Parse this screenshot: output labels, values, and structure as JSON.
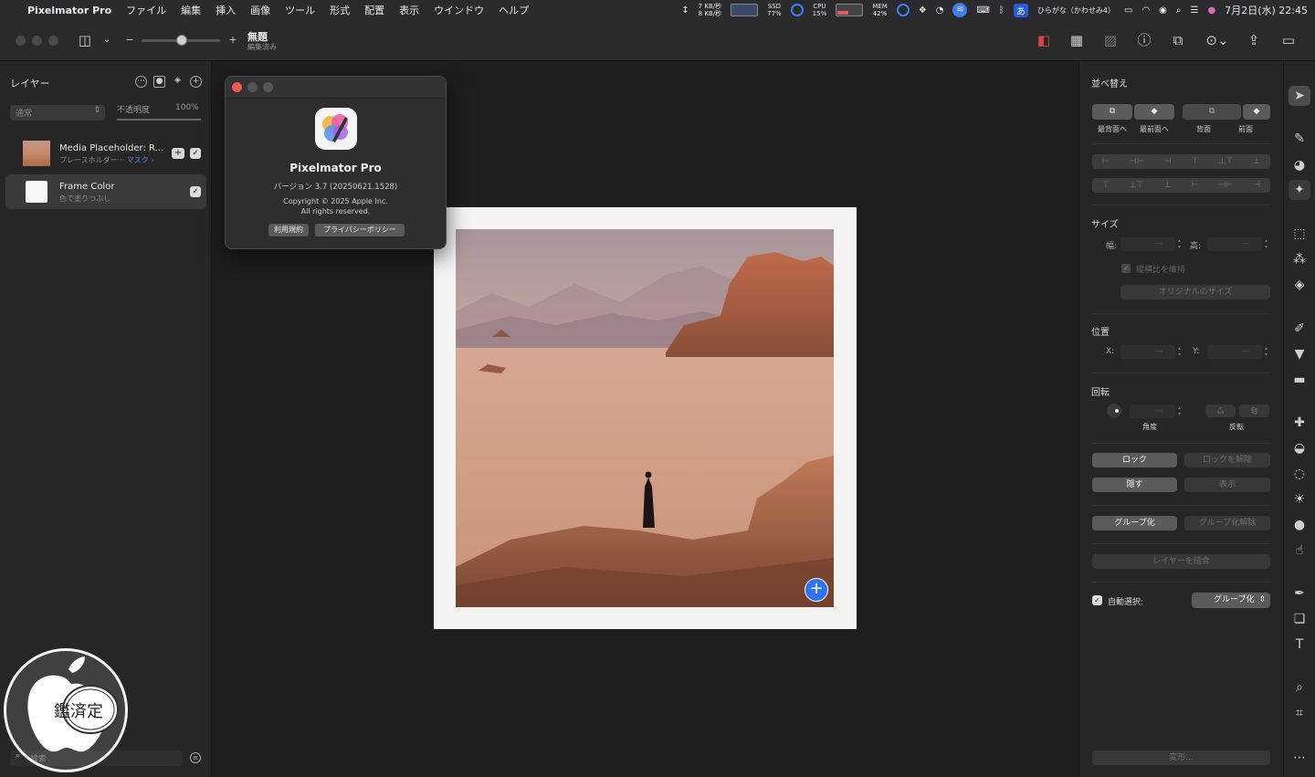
{
  "menubar": {
    "app_name": "Pixelmator Pro",
    "menus": [
      "ファイル",
      "編集",
      "挿入",
      "画像",
      "ツール",
      "形式",
      "配置",
      "表示",
      "ウインドウ",
      "ヘルプ"
    ],
    "net_up": "7 KB/秒",
    "net_down": "8 KB/秒",
    "ssd_label": "SSD",
    "ssd_value": "77%",
    "cpu_label": "CPU",
    "cpu_value": "15%",
    "mem_label": "MEM",
    "mem_value": "42%",
    "input_method": "ひらがな（かわせみ4）",
    "input_badge": "あ",
    "datetime": "7月2日(水) 22:45"
  },
  "toolbar": {
    "doc_title": "無題",
    "doc_status": "編集済み",
    "zoom_minus": "−",
    "zoom_plus": "+",
    "zoom_level": 0.5
  },
  "layers": {
    "title": "レイヤー",
    "blend_mode": "通常",
    "opacity_label": "不透明度",
    "opacity_value": "100%",
    "items": [
      {
        "name": "Media Placeholder: R...",
        "sub": "プレースホルダー···",
        "mask": "マスク ›",
        "visible": true
      },
      {
        "name": "Frame Color",
        "sub": "色で塗りつぶし",
        "visible": true
      }
    ],
    "search_placeholder": "検索"
  },
  "about": {
    "app_name": "Pixelmator Pro",
    "version": "バージョン 3.7 (20250621.1528)",
    "copyright": "Copyright © 2025 Apple Inc.",
    "rights": "All rights reserved.",
    "terms_button": "利用規約",
    "privacy_button": "プライバシーポリシー"
  },
  "inspector": {
    "arrange_title": "並べ替え",
    "arrange_labels": [
      "最背面へ",
      "最前面へ",
      "背面",
      "前面"
    ],
    "size_title": "サイズ",
    "width_label": "幅:",
    "height_label": "高:",
    "empty_value": "---",
    "keep_ratio": "縦横比を維持",
    "original_size": "オリジナルのサイズ",
    "position_title": "位置",
    "x_label": "X:",
    "y_label": "Y:",
    "rotation_title": "回転",
    "angle_label": "角度",
    "flip_label": "反転",
    "lock": "ロック",
    "unlock": "ロックを解除",
    "hide": "隠す",
    "show": "表示",
    "group": "グループ化",
    "ungroup": "グループ化解除",
    "merge": "レイヤーを結合",
    "auto_select_label": "自動選択:",
    "auto_select_value": "グループ化",
    "transform": "変形..."
  },
  "watermark": {
    "text": "鑑済定"
  }
}
